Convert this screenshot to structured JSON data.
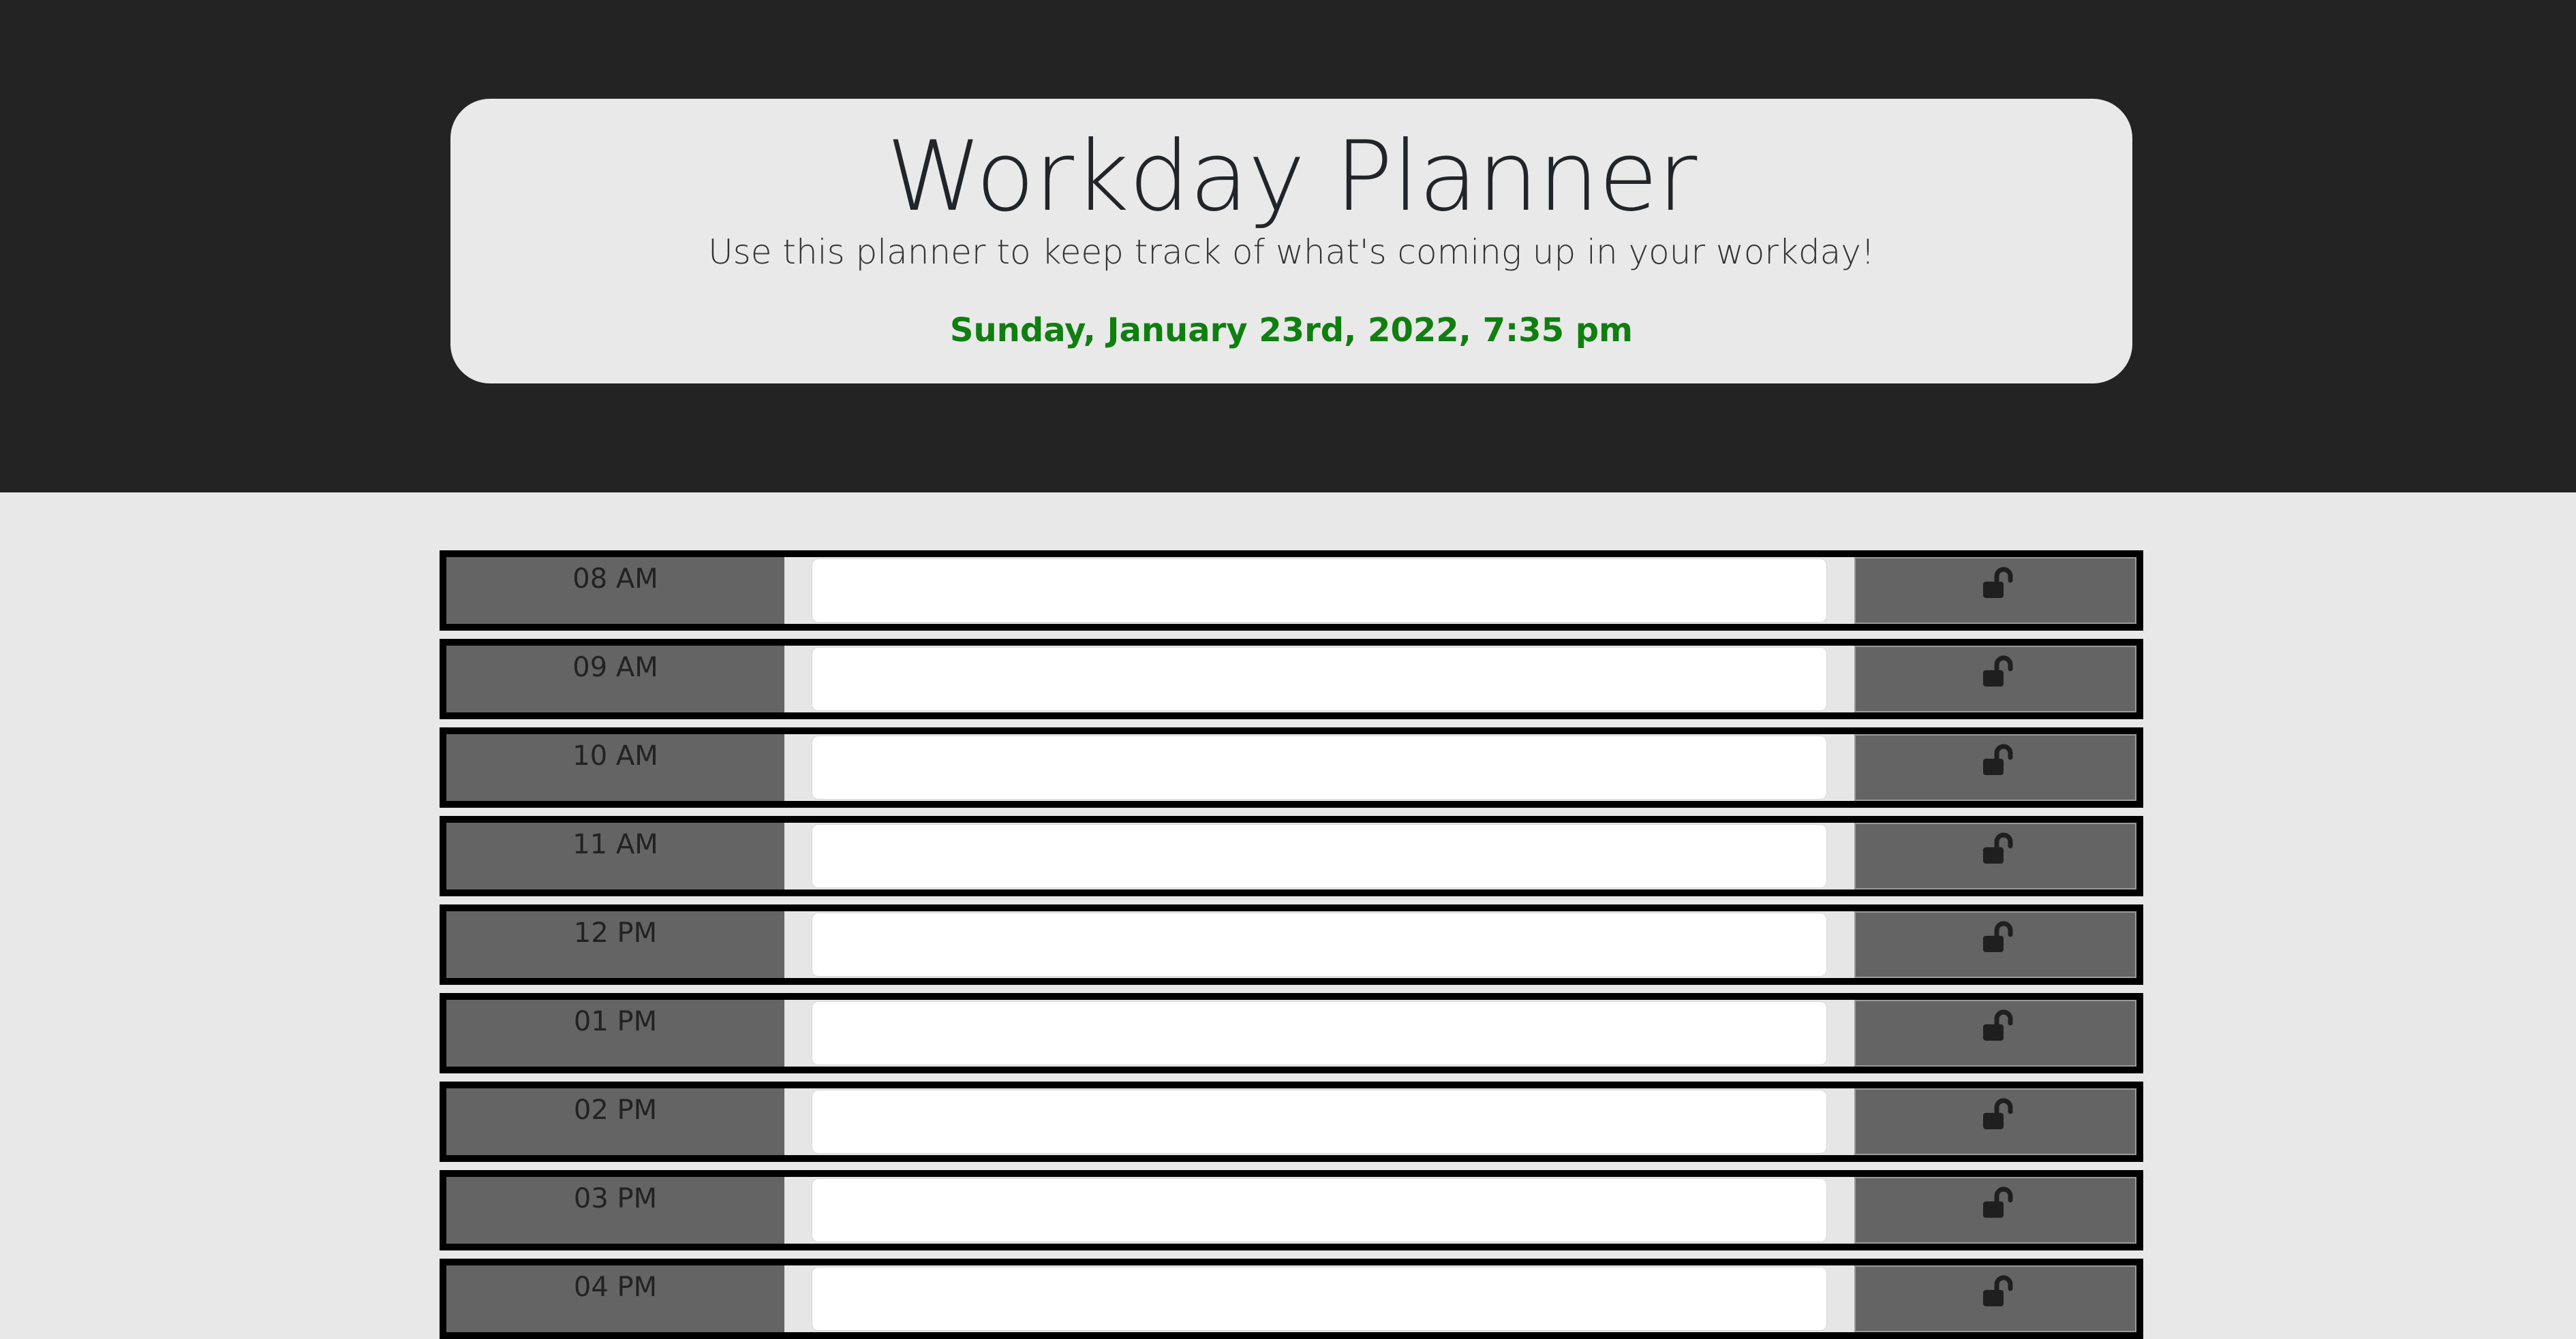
{
  "header": {
    "title": "Workday Planner",
    "subtitle": "Use this planner to keep track of what's coming up in your workday!",
    "current_day": "Sunday, January 23rd, 2022, 7:35 pm"
  },
  "colors": {
    "header_background": "#232323",
    "page_background": "#e8e8e8",
    "date_text": "#0f7f10",
    "hour_cell": "#646464",
    "save_button": "#646464"
  },
  "planner": {
    "save_icon": "unlocked-padlock-icon",
    "hours": [
      {
        "label": "08 AM",
        "value": ""
      },
      {
        "label": "09 AM",
        "value": ""
      },
      {
        "label": "10 AM",
        "value": ""
      },
      {
        "label": "11 AM",
        "value": ""
      },
      {
        "label": "12 PM",
        "value": ""
      },
      {
        "label": "01 PM",
        "value": ""
      },
      {
        "label": "02 PM",
        "value": ""
      },
      {
        "label": "03 PM",
        "value": ""
      },
      {
        "label": "04 PM",
        "value": ""
      }
    ]
  }
}
